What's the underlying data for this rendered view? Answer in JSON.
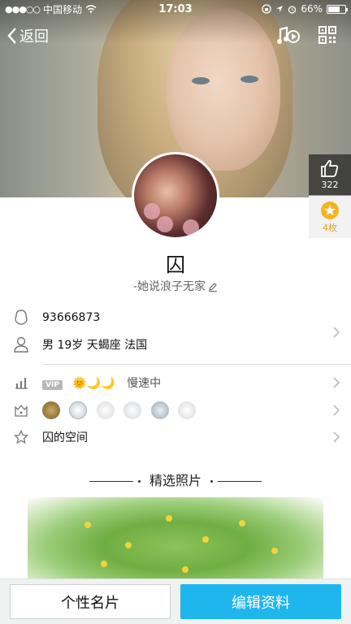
{
  "status_bar": {
    "signal": "●●●○○",
    "carrier": "中国移动",
    "time": "17:03",
    "battery": "66%",
    "battery_level": 0.66
  },
  "nav": {
    "back_label": "返回",
    "icons": [
      "music-note-icon",
      "qr-code-icon"
    ]
  },
  "likes": {
    "count": "322"
  },
  "gifts": {
    "label": "4枚"
  },
  "profile": {
    "nickname": "囚",
    "signature": "-她说浪子无家"
  },
  "info": {
    "qq_number": "93666873",
    "details": "男 19岁 天蝎座 法国",
    "vip_badge": "VIP",
    "level_icons": "🌞🌙🌙",
    "speed_label": "慢速中",
    "space_label": "囚的空间"
  },
  "section": {
    "title": "精选照片"
  },
  "buttons": {
    "card_label": "个性名片",
    "edit_label": "编辑资料"
  },
  "colors": {
    "accent": "#1fb6ee",
    "gift": "#f5b323"
  }
}
